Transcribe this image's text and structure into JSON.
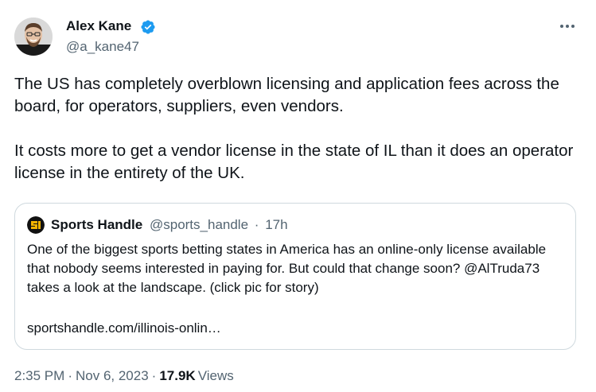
{
  "author": {
    "name": "Alex Kane",
    "handle": "@a_kane47",
    "verified_icon": "verified-badge-icon",
    "verified_color": "#1d9bf0"
  },
  "more_icon": "more-options-icon",
  "tweet": {
    "paragraph_1": "The US has completely overblown licensing and application fees across the board, for operators, suppliers, even vendors.",
    "paragraph_2": "It costs more to get a vendor license in the state of IL than it does an operator license in the entirety of the UK."
  },
  "quote": {
    "name": "Sports Handle",
    "handle": "@sports_handle",
    "separator": "·",
    "time": "17h",
    "text": "One of the biggest sports betting states in America has an online-only license available that nobody seems interested in paying for. But could that change soon? @AlTruda73 takes a look at the landscape. (click pic for story)",
    "link": "sportshandle.com/illinois-onlin…"
  },
  "meta": {
    "time": "2:35 PM",
    "separator": "·",
    "date": "Nov 6, 2023",
    "views_count": "17.9K",
    "views_label": "Views"
  },
  "colors": {
    "text": "#0f1419",
    "secondary": "#536471",
    "border": "#cfd9de",
    "accent": "#1d9bf0"
  }
}
